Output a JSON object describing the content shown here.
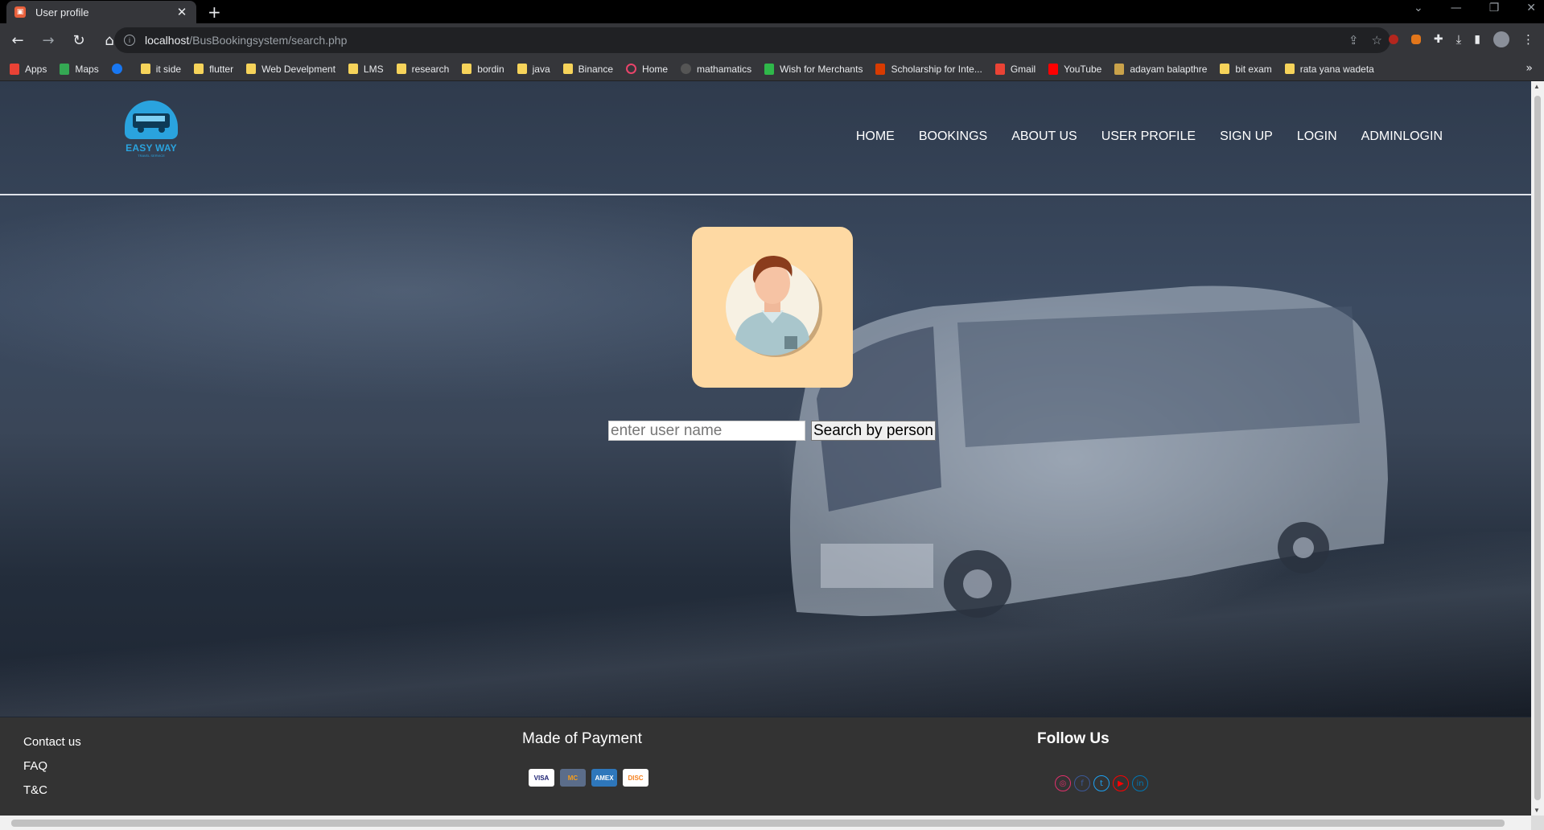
{
  "browser": {
    "tab_title": "User profile",
    "tab_close": "✕",
    "new_tab": "+",
    "url_host": "localhost",
    "url_path": "/BusBookingsystem/search.php",
    "bookmarks": [
      {
        "label": "Apps",
        "icon": "apps-grid-icon",
        "color": "#e94235"
      },
      {
        "label": "Maps",
        "icon": "maps-pin-icon",
        "color": "#34a853"
      },
      {
        "label": "",
        "icon": "facebook-icon",
        "color": "#1877f2"
      },
      {
        "label": "it side",
        "icon": "folder-icon"
      },
      {
        "label": "flutter",
        "icon": "folder-icon"
      },
      {
        "label": "Web Develpment",
        "icon": "folder-icon"
      },
      {
        "label": "LMS",
        "icon": "folder-icon"
      },
      {
        "label": "research",
        "icon": "folder-icon"
      },
      {
        "label": "bordin",
        "icon": "folder-icon"
      },
      {
        "label": "java",
        "icon": "folder-icon"
      },
      {
        "label": "Binance",
        "icon": "folder-icon"
      },
      {
        "label": "Home",
        "icon": "home-ring-icon",
        "color": "#e9446a"
      },
      {
        "label": "mathamatics",
        "icon": "globe-icon",
        "color": "#555"
      },
      {
        "label": "Wish for Merchants",
        "icon": "wish-icon",
        "color": "#2fb84a"
      },
      {
        "label": "Scholarship for Inte...",
        "icon": "365-icon",
        "color": "#d83b01"
      },
      {
        "label": "Gmail",
        "icon": "gmail-icon",
        "color": "#ea4335"
      },
      {
        "label": "YouTube",
        "icon": "youtube-icon",
        "color": "#ff0000"
      },
      {
        "label": "adayam balapthre",
        "icon": "crown-icon",
        "color": "#c9a24a"
      },
      {
        "label": "bit exam",
        "icon": "folder-icon"
      },
      {
        "label": "rata yana wadeta",
        "icon": "folder-icon"
      }
    ],
    "bookmarks_more": "»"
  },
  "header": {
    "logo_brand": "EASY WAY",
    "logo_tagline": "TRAVEL SERVICE",
    "nav": [
      "HOME",
      "BOOKINGS",
      "ABOUT US",
      "USER PROFILE",
      "SIGN UP",
      "LOGIN",
      "ADMINLOGIN"
    ]
  },
  "search": {
    "placeholder": "enter user name",
    "button_label": "Search by person"
  },
  "footer": {
    "links": [
      "Contact us",
      "FAQ",
      "T&C"
    ],
    "payment_title": "Made of Payment",
    "cards": [
      {
        "label": "VISA",
        "bg": "#ffffff",
        "fg": "#1a1f71"
      },
      {
        "label": "MC",
        "bg": "#5b6d8a",
        "fg": "#f79e1b"
      },
      {
        "label": "AMEX",
        "bg": "#2e77bb",
        "fg": "#ffffff"
      },
      {
        "label": "DISC",
        "bg": "#ffffff",
        "fg": "#f58220"
      }
    ],
    "follow_title": "Follow Us",
    "socials": [
      {
        "icon": "instagram-icon",
        "glyph": "◎",
        "color": "#e1306c"
      },
      {
        "icon": "facebook-icon",
        "glyph": "f",
        "color": "#3b5998"
      },
      {
        "icon": "twitter-icon",
        "glyph": "t",
        "color": "#1da1f2"
      },
      {
        "icon": "youtube-icon",
        "glyph": "▶",
        "color": "#ff0000"
      },
      {
        "icon": "linkedin-icon",
        "glyph": "in",
        "color": "#0077b5"
      }
    ]
  }
}
